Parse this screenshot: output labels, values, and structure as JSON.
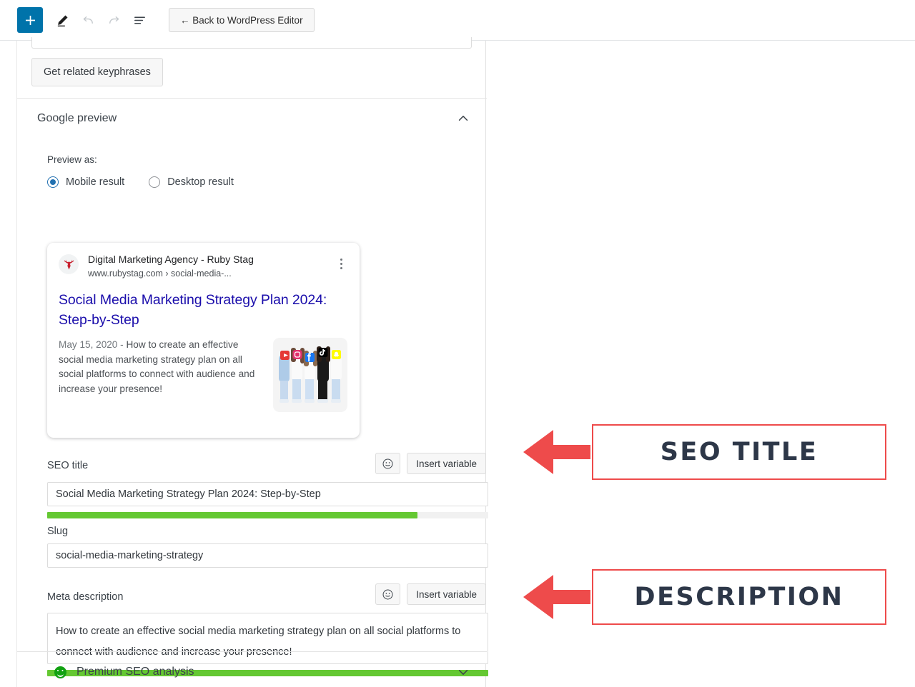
{
  "toolbar": {
    "add_icon": "plus-icon",
    "edit_icon": "pencil-icon",
    "undo_icon": "undo-arrow-icon",
    "redo_icon": "redo-arrow-icon",
    "outline_icon": "document-outline-icon",
    "back_label": "← Back to WordPress Editor"
  },
  "panel": {
    "get_related_keyphrases": "Get related keyphrases",
    "section_title": "Google preview",
    "collapse_icon": "chevron-up-icon",
    "preview_as_label": "Preview as:",
    "radios": [
      {
        "label": "Mobile result",
        "selected": true
      },
      {
        "label": "Desktop result",
        "selected": false
      }
    ]
  },
  "preview_card": {
    "favicon_icon": "ruby-stag-logo-icon",
    "site_name": "Digital Marketing Agency - Ruby Stag",
    "url": "www.rubystag.com › social-media-...",
    "menu_icon": "three-dots-vertical-icon",
    "title": "Social Media Marketing Strategy Plan 2024: Step-by-Step",
    "date": "May 15, 2020",
    "separator": "-",
    "description": "How to create an effective social media marketing strategy plan on all social platforms to connect with audience and increase your presence!",
    "thumbnail_alt": "five-people-holding-social-media-icons"
  },
  "fields": {
    "seo_title": {
      "label": "SEO title",
      "emoji_icon": "smiley-face-icon",
      "insert_variable_label": "Insert variable",
      "value": "Social Media Marketing Strategy Plan 2024: Step-by-Step",
      "progress_percent": 84,
      "progress_color": "#64c832"
    },
    "slug": {
      "label": "Slug",
      "value": "social-media-marketing-strategy"
    },
    "meta_description": {
      "label": "Meta description",
      "emoji_icon": "smiley-face-icon",
      "insert_variable_label": "Insert variable",
      "value": "How to create an effective social media marketing strategy plan on all social platforms to connect with audience and increase your presence!",
      "progress_percent": 100,
      "progress_color": "#64c832"
    }
  },
  "seo_analysis": {
    "label": "Premium SEO analysis",
    "status_icon": "green-smiley-icon",
    "status_color": "#11a111",
    "expand_icon": "chevron-down-icon"
  },
  "annotations": [
    {
      "text": "SEO TITLE",
      "arrow_icon": "left-arrow-icon",
      "arrow_color": "#ee4b4b",
      "border_color": "#ee4b4b",
      "text_color": "#2d3748"
    },
    {
      "text": "DESCRIPTION",
      "arrow_icon": "left-arrow-icon",
      "arrow_color": "#ee4b4b",
      "border_color": "#ee4b4b",
      "text_color": "#2d3748"
    }
  ]
}
